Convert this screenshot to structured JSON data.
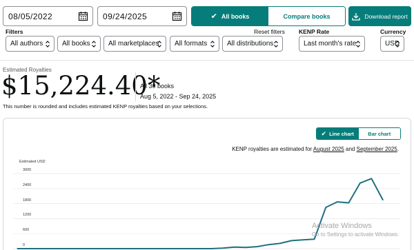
{
  "date_from": "08/05/2022",
  "date_to": "09/24/2025",
  "view_toggle": {
    "all_books": "All books",
    "compare_books": "Compare books"
  },
  "download_label": "Download report",
  "filters": {
    "label": "Filters",
    "reset_label": "Reset filters",
    "authors": "All authors",
    "books": "All books",
    "marketplaces": "All marketplaces",
    "formats": "All formats",
    "distributions": "All distributions"
  },
  "kenp_rate": {
    "label": "KENP Rate",
    "value": "Last month's rate"
  },
  "currency": {
    "label": "Currency",
    "value": "USD"
  },
  "summary": {
    "label": "Estimated Royalties",
    "amount": "$15,224.40*",
    "books_count": "All 30 books",
    "range": "Aug 5, 2022 - Sep 24, 2025",
    "note": "This number is rounded and includes estimated KENP royalties based on your selections."
  },
  "chart_toggle": {
    "line": "Line chart",
    "bar": "Bar chart"
  },
  "kenp_note": {
    "prefix": "KENP royalties are estimated for ",
    "month1": "August 2025",
    "and": " and ",
    "month2": "September 2025",
    "suffix": "."
  },
  "watermark": {
    "line1": "Activate Windows",
    "line2": "Go to Settings to activate Windows."
  },
  "chart_data": {
    "type": "line",
    "ylabel": "Estimated USD",
    "yticks": [
      "3000",
      "2400",
      "1800",
      "1200",
      "600",
      "0"
    ],
    "ylim": [
      0,
      3000
    ],
    "grid": true,
    "series": [
      {
        "values": [
          0,
          0,
          0,
          0,
          0,
          0,
          0,
          0,
          0,
          0,
          0,
          0,
          0,
          0,
          0,
          0,
          0,
          0,
          20,
          60,
          50,
          80,
          160,
          210,
          320,
          350,
          380,
          1650,
          1870,
          1830,
          2620,
          2800,
          1940
        ]
      }
    ],
    "color": "#1f6f7f"
  }
}
